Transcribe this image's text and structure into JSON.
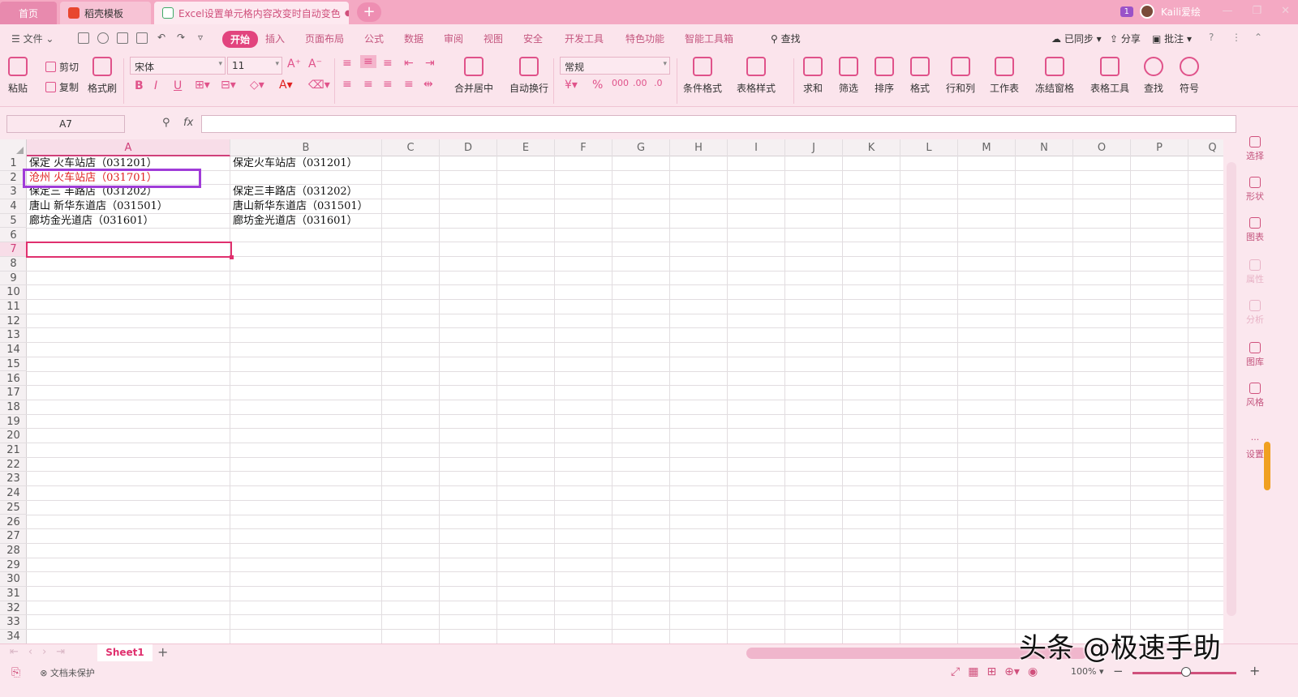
{
  "tabs": {
    "home": "首页",
    "daoke": "稻壳模板",
    "document": "Excel设置单元格内容改变时自动变色"
  },
  "titlebar": {
    "badge": "1",
    "user": "Kaili爱绘"
  },
  "menu": {
    "file": "文件",
    "items": [
      "开始",
      "插入",
      "页面布局",
      "公式",
      "数据",
      "审阅",
      "视图",
      "安全",
      "开发工具",
      "特色功能",
      "智能工具箱"
    ],
    "search": "查找",
    "sync": "已同步",
    "share": "分享",
    "comment": "批注"
  },
  "ribbon": {
    "paste": "粘贴",
    "cut": "剪切",
    "copy": "复制",
    "format_painter": "格式刷",
    "font_name": "宋体",
    "font_size": "11",
    "merge": "合并居中",
    "wrap": "自动换行",
    "number_format": "常规",
    "cond_format": "条件格式",
    "table_style": "表格样式",
    "sum": "求和",
    "filter": "筛选",
    "sort": "排序",
    "format": "格式",
    "row_col": "行和列",
    "worksheet": "工作表",
    "freeze": "冻结窗格",
    "table_tools": "表格工具",
    "find": "查找",
    "symbol": "符号"
  },
  "formula_bar": {
    "name_box": "A7",
    "fx": "fx",
    "value": ""
  },
  "grid": {
    "columns": [
      "A",
      "B",
      "C",
      "D",
      "E",
      "F",
      "G",
      "H",
      "I",
      "J",
      "K",
      "L",
      "M",
      "N",
      "O",
      "P",
      "Q"
    ],
    "active_column": "A",
    "active_row": "7",
    "rows": [
      "1",
      "2",
      "3",
      "4",
      "5",
      "6",
      "7",
      "8",
      "9",
      "10",
      "11",
      "12",
      "13",
      "14",
      "15",
      "16",
      "17",
      "18",
      "19",
      "20",
      "21",
      "22",
      "23",
      "24",
      "25",
      "26",
      "27",
      "28",
      "29",
      "30",
      "31",
      "32",
      "33",
      "34"
    ],
    "cells": {
      "A1": "保定 火车站店（031201）",
      "B1": "保定火车站店（031201）",
      "A2": "沧州 火车站店（031701）",
      "A3": "保定三 丰路店（031202）",
      "B3": "保定三丰路店（031202）",
      "A4": "唐山 新华东道店（031501）",
      "B4": "唐山新华东道店（031501）",
      "A5": "廊坊金光道店（031601）",
      "B5": "廊坊金光道店（031601）"
    },
    "changed_cell_color": "#e02020"
  },
  "right_panel": [
    "选择",
    "形状",
    "图表",
    "属性",
    "分析",
    "图库",
    "风格",
    "设置"
  ],
  "sheets": {
    "active": "Sheet1"
  },
  "status": {
    "protect": "文档未保护",
    "zoom": "100%"
  },
  "watermark": "头条 @极速手助",
  "colors": {
    "accent": "#e2447e",
    "titlebar": "#f4a9c3",
    "highlight_box": "#a03cd8"
  }
}
